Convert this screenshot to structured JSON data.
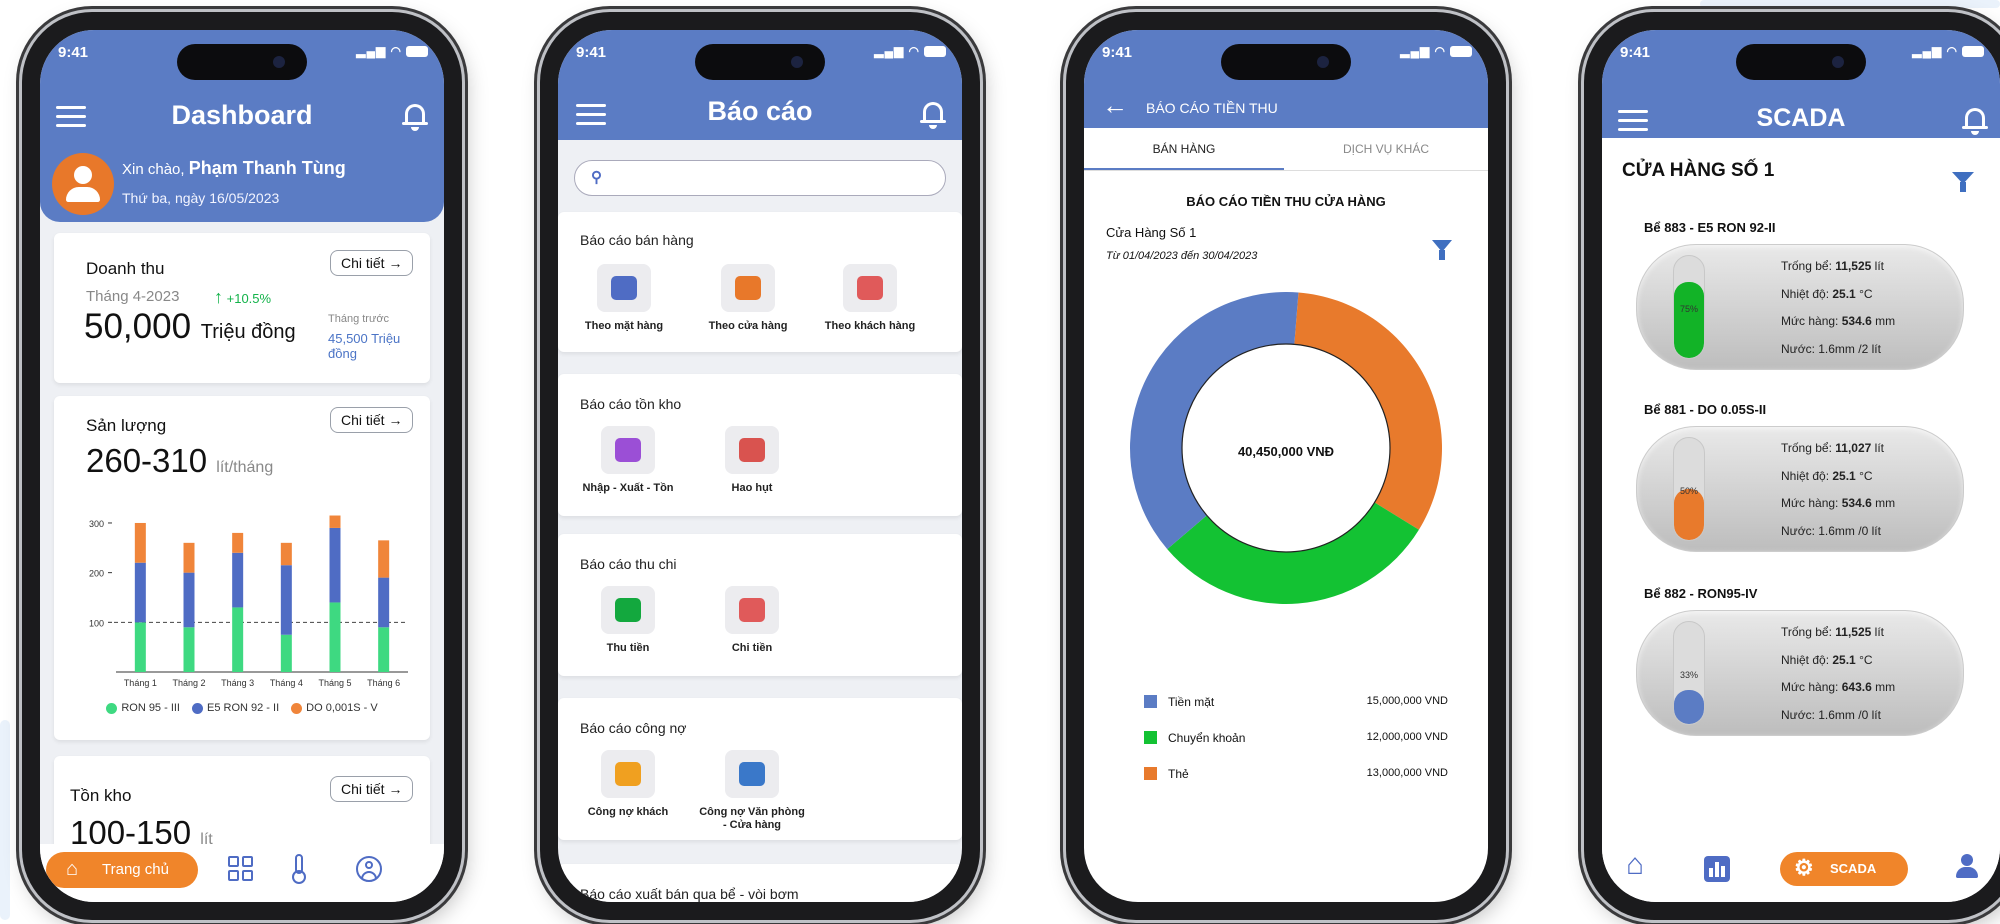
{
  "status": {
    "time": "9:41"
  },
  "colors": {
    "header": "#5b7cc4",
    "orange": "#e8782a",
    "green": "#13c94a",
    "blue": "#5b7cc4",
    "filter": "#3f6fc0"
  },
  "dashboard": {
    "title": "Dashboard",
    "greeting_prefix": "Xin chào,",
    "user_name": "Phạm Thanh Tùng",
    "date": "Thứ ba, ngày 16/05/2023",
    "revenue": {
      "title": "Doanh thu",
      "detail": "Chi tiết",
      "period": "Tháng 4-2023",
      "change": "+10.5%",
      "value": "50,000",
      "unit": "Triệu đồng",
      "prev_label": "Tháng trước",
      "prev_value": "45,500 Triệu đồng"
    },
    "output": {
      "title": "Sản lượng",
      "detail": "Chi tiết",
      "value": "260-310",
      "unit": "lít/tháng"
    },
    "inventory": {
      "title": "Tồn kho",
      "detail": "Chi tiết",
      "value": "100-150",
      "unit": "lít"
    },
    "nav": {
      "home": "Trang chủ",
      "home_icon": "home-icon",
      "apps_icon": "grid-icon",
      "temp_icon": "thermometer-icon",
      "user_icon": "user-icon"
    }
  },
  "chart_data": {
    "type": "bar",
    "stacked": true,
    "categories": [
      "Tháng 1",
      "Tháng 2",
      "Tháng 3",
      "Tháng 4",
      "Tháng 5",
      "Tháng 6"
    ],
    "series": [
      {
        "name": "RON 95 - III",
        "color": "#3ed981",
        "values": [
          100,
          90,
          130,
          75,
          140,
          90
        ]
      },
      {
        "name": "E5 RON 92 - II",
        "color": "#4f6cc4",
        "values": [
          120,
          110,
          110,
          140,
          150,
          100
        ]
      },
      {
        "name": "DO 0,001S - V",
        "color": "#f0853a",
        "values": [
          80,
          60,
          40,
          45,
          25,
          75
        ]
      }
    ],
    "yticks": [
      100,
      200,
      300
    ],
    "ylim": [
      0,
      310
    ],
    "reference_line": 100
  },
  "reports": {
    "title": "Báo cáo",
    "search_placeholder": "",
    "sections": [
      {
        "title": "Báo cáo bán hàng",
        "items": [
          {
            "label": "Theo mặt hàng",
            "icon": "fuel-drop-icon",
            "color": "#4f6cc4"
          },
          {
            "label": "Theo cửa hàng",
            "icon": "gas-pump-icon",
            "color": "#e8782a"
          },
          {
            "label": "Theo khách hàng",
            "icon": "customers-icon",
            "color": "#e05a5a"
          }
        ]
      },
      {
        "title": "Báo cáo tồn kho",
        "items": [
          {
            "label": "Nhập - Xuất - Tồn",
            "icon": "bars-icon",
            "color": "#9b4fd6"
          },
          {
            "label": "Hao hụt",
            "icon": "decline-chart-icon",
            "color": "#d9534f"
          }
        ]
      },
      {
        "title": "Báo cáo thu chi",
        "items": [
          {
            "label": "Thu tiền",
            "icon": "money-in-icon",
            "color": "#13a83e"
          },
          {
            "label": "Chi tiền",
            "icon": "money-out-icon",
            "color": "#e05a5a"
          }
        ]
      },
      {
        "title": "Báo cáo công nợ",
        "items": [
          {
            "label": "Công nợ khách",
            "icon": "pie-icon",
            "color": "#f0a020"
          },
          {
            "label": "Công nợ Văn phòng - Cửa hàng",
            "icon": "column-chart-icon",
            "color": "#3a78c9"
          }
        ]
      },
      {
        "title": "Báo cáo xuất bán qua bể - vòi bơm",
        "items": []
      }
    ]
  },
  "revenue_report": {
    "title": "BÁO CÁO TIỀN THU",
    "tab_sales": "BÁN HÀNG",
    "tab_other": "DỊCH VỤ KHÁC",
    "heading": "BÁO CÁO TIỀN THU CỬA HÀNG",
    "store": "Cửa Hàng Số 1",
    "range": "Từ 01/04/2023 đến 30/04/2023",
    "total": "40,450,000 VNĐ",
    "donut": [
      {
        "label": "Tiền mặt",
        "value": 15000000,
        "display": "15,000,000 VND",
        "color": "#5b7cc4"
      },
      {
        "label": "Chuyển khoản",
        "value": 12000000,
        "display": "12,000,000 VND",
        "color": "#13c233"
      },
      {
        "label": "Thẻ",
        "value": 13000000,
        "display": "13,000,000 VND",
        "color": "#e87a2c"
      }
    ]
  },
  "scada": {
    "title": "SCADA",
    "store": "CỬA HÀNG SỐ 1",
    "nav_label": "SCADA",
    "tanks": [
      {
        "name": "Bể 883 - E5 RON 92-II",
        "level": 0.75,
        "pct_label": "75%",
        "color": "#12b327",
        "cap_label": "Trống bể:",
        "cap": "11,525",
        "cap_unit": "lít",
        "temp_label": "Nhiệt độ:",
        "temp": "25.1",
        "temp_unit": "°C",
        "lvl_label": "Mức hàng:",
        "lvl": "534.6",
        "lvl_unit": "mm",
        "water": "Nước: 1.6mm /2 lít"
      },
      {
        "name": "Bể 881 - DO 0.05S-II",
        "level": 0.5,
        "pct_label": "50%",
        "color": "#e87a2c",
        "cap_label": "Trống bể:",
        "cap": "11,027",
        "cap_unit": "lít",
        "temp_label": "Nhiệt độ:",
        "temp": "25.1",
        "temp_unit": "°C",
        "lvl_label": "Mức hàng:",
        "lvl": "534.6",
        "lvl_unit": "mm",
        "water": "Nước: 1.6mm /0 lít"
      },
      {
        "name": "Bể 882 - RON95-IV",
        "level": 0.33,
        "pct_label": "33%",
        "color": "#5b7cc4",
        "cap_label": "Trống bể:",
        "cap": "11,525",
        "cap_unit": "lít",
        "temp_label": "Nhiệt độ:",
        "temp": "25.1",
        "temp_unit": "°C",
        "lvl_label": "Mức hàng:",
        "lvl": "643.6",
        "lvl_unit": "mm",
        "water": "Nước: 1.6mm /0 lít"
      }
    ]
  }
}
